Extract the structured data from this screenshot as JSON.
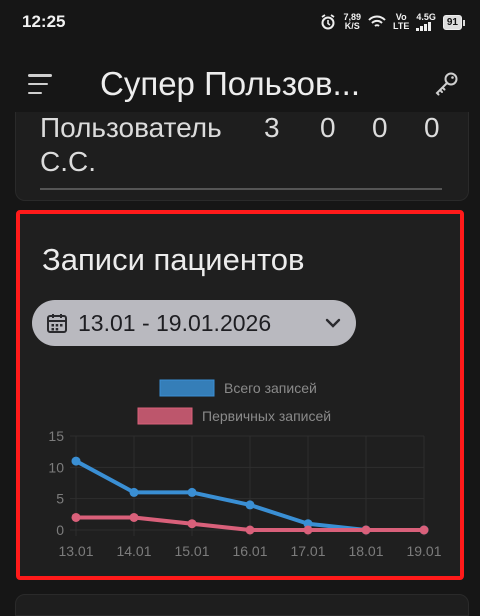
{
  "status_bar": {
    "time": "12:25",
    "speed": "7,89",
    "speed_unit": "K/S",
    "volte_top": "Vo",
    "volte_bottom": "LTE",
    "network": "4.5G",
    "battery": "91",
    "icons": [
      "alarm-icon",
      "wifi-icon",
      "signal-icon",
      "battery-icon"
    ]
  },
  "app_bar": {
    "title": "Супер Пользов...",
    "icons": [
      "menu-icon",
      "key-icon"
    ]
  },
  "previous_card": {
    "row_label_line1": "Пользователь",
    "row_values": [
      "3",
      "0",
      "0",
      "0"
    ],
    "row_label_line2": "С.С."
  },
  "card": {
    "title": "Записи пациентов",
    "date_range": "13.01 - 19.01.2026"
  },
  "chart_data": {
    "type": "line",
    "categories": [
      "13.01",
      "14.01",
      "15.01",
      "16.01",
      "17.01",
      "18.01",
      "19.01"
    ],
    "series": [
      {
        "name": "Всего записей",
        "color": "#3a8fd4",
        "values": [
          11,
          6,
          6,
          4,
          1,
          0,
          0
        ]
      },
      {
        "name": "Первичных записей",
        "color": "#d9607a",
        "values": [
          2,
          2,
          1,
          0,
          0,
          0,
          0
        ]
      }
    ],
    "yticks": [
      0,
      5,
      10,
      15
    ],
    "ylim": [
      0,
      15
    ],
    "grid": true,
    "legend_position": "top-center"
  }
}
